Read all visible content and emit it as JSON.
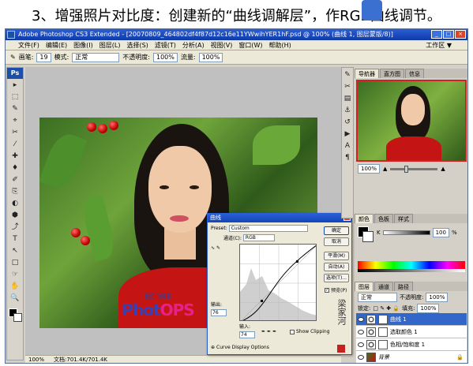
{
  "caption": "3、增强照片对比度：创建新的“曲线调解层”，作RGB曲线调节。",
  "window": {
    "title": "Adobe Photoshop CS3 Extended - [20070809_464802df4f87d12c16e11YWwihYER1hF.psd @ 100% (曲线 1, 图层蒙版/8)]",
    "buttons": [
      "_",
      "□",
      "×"
    ]
  },
  "menu": {
    "items": [
      "文件(F)",
      "编辑(E)",
      "图像(I)",
      "图层(L)",
      "选择(S)",
      "滤镜(T)",
      "分析(A)",
      "视图(V)",
      "窗口(W)",
      "帮助(H)"
    ],
    "workspace": "工作区 ▼"
  },
  "options": {
    "brush_label": "画笔:",
    "brush_size": "19",
    "mode_label": "模式:",
    "mode_value": "正常",
    "opacity_label": "不透明度:",
    "opacity_value": "100%",
    "flow_label": "流量:",
    "flow_value": "100%"
  },
  "toolbox": {
    "logo": "Ps",
    "tools": [
      "▸",
      "⬚",
      "✎",
      "⌖",
      "✂",
      "⁄",
      "✚",
      "♦",
      "✐",
      "⎘",
      "◐",
      "⬢",
      "⤴",
      "T",
      "↖",
      "□",
      "☞",
      "✋",
      "🔍"
    ]
  },
  "status": {
    "zoom": "100%",
    "doc": "文档:701.4K/701.4K"
  },
  "watermark": {
    "small": "我们的博客",
    "big_part1": "Phot",
    "big_part2": "OPS"
  },
  "curves": {
    "title": "曲线",
    "preset_label": "Preset:",
    "preset_value": "Custom",
    "channel_label": "通道(C):",
    "channel_value": "RGB",
    "output_label": "输出:",
    "output_value": "76",
    "input_label": "输入:",
    "input_value": "74",
    "show_clipping": "Show Clipping",
    "options_label": "Curve Display Options",
    "buttons": [
      "确定",
      "取消",
      "平滑(M)",
      "自动(A)",
      "选项(T)..."
    ],
    "preview": "预览(P)"
  },
  "signature": "梁家河",
  "panels": {
    "nav_tabs": [
      "导航器",
      "直方图",
      "信息"
    ],
    "nav_zoom": "100%",
    "color_tabs": [
      "颜色",
      "色板",
      "样式"
    ],
    "color_channel": "K",
    "color_value": "100",
    "color_unit": "%",
    "layer_tabs": [
      "图层",
      "通道",
      "路径"
    ],
    "blend_mode": "正常",
    "opacity_label": "不透明度:",
    "opacity_value": "100%",
    "lock_label": "锁定:",
    "fill_label": "填充:",
    "fill_value": "100%",
    "layers": [
      {
        "name": "曲线 1",
        "selected": true
      },
      {
        "name": "选取颜色 1",
        "selected": false
      },
      {
        "name": "色相/饱和度 1",
        "selected": false
      },
      {
        "name": "背景",
        "selected": false
      }
    ]
  },
  "colors": {
    "title_bar": "#2a5ed6",
    "selection": "#3167c8",
    "brand_pink": "#e8208a"
  }
}
